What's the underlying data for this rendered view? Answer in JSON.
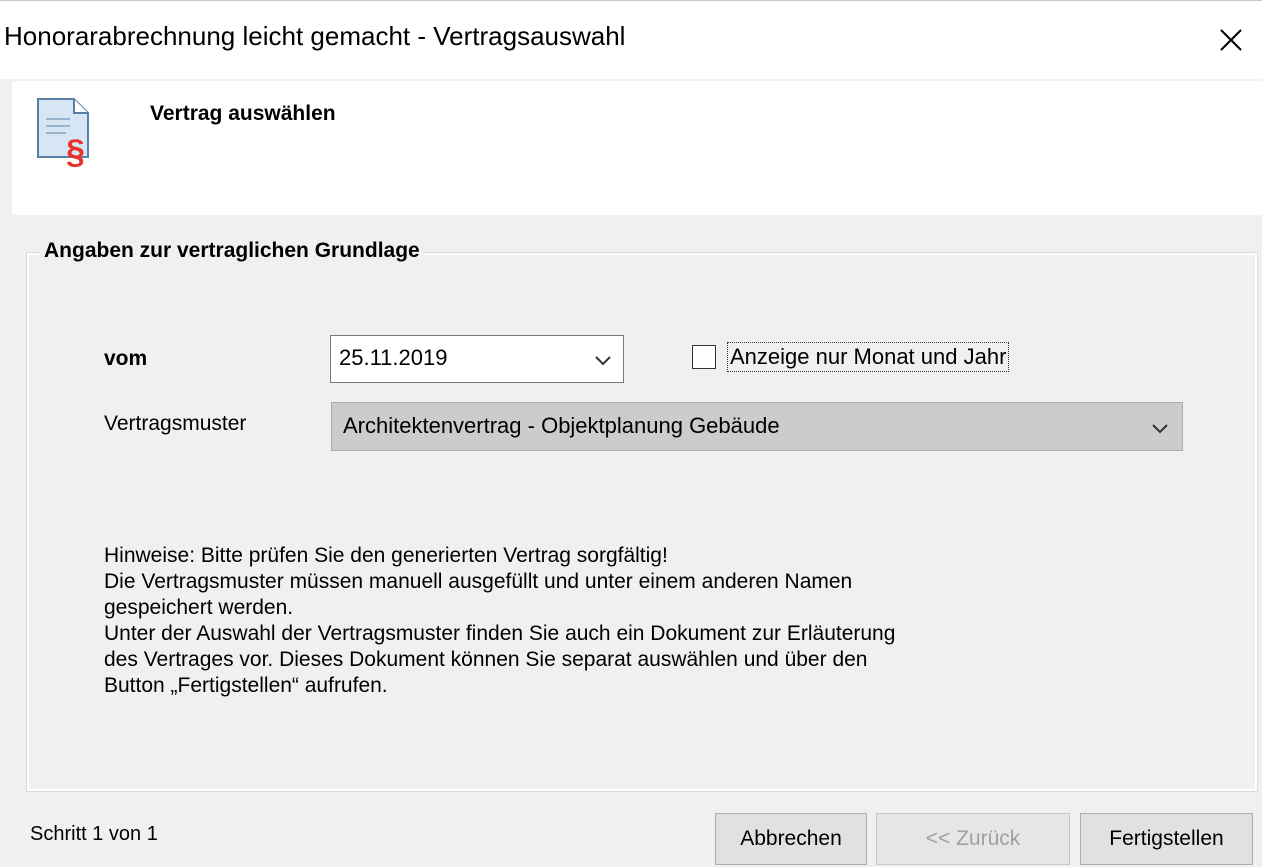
{
  "window": {
    "title": "Honorarabrechnung leicht gemacht - Vertragsauswahl"
  },
  "header": {
    "title": "Vertrag auswählen",
    "icon": "contract-document-icon"
  },
  "group": {
    "title": "Angaben zur vertraglichen Grundlage"
  },
  "form": {
    "date_label": "vom",
    "date_value": "25.11.2019",
    "checkbox_label": "Anzeige nur Monat und Jahr",
    "checkbox_checked": false,
    "template_label": "Vertragsmuster",
    "template_value": "Architektenvertrag - Objektplanung Gebäude"
  },
  "hint": {
    "lines": [
      "Hinweise: Bitte prüfen Sie den generierten Vertrag sorgfältig!",
      "Die Vertragsmuster müssen manuell ausgefüllt und unter einem anderen Namen",
      "gespeichert werden.",
      "Unter der Auswahl der Vertragsmuster finden Sie auch ein Dokument zur Erläuterung",
      "des Vertrages vor. Dieses Dokument können Sie separat auswählen und über den",
      "Button „Fertigstellen“ aufrufen."
    ]
  },
  "footer": {
    "step": "Schritt 1 von 1",
    "cancel_label": "Abbrechen",
    "back_label": "<< Zurück",
    "finish_label": "Fertigstellen"
  },
  "colors": {
    "accent_red": "#e8322a",
    "window_bg": "#f0f0f0",
    "select_bg": "#cccccc"
  }
}
